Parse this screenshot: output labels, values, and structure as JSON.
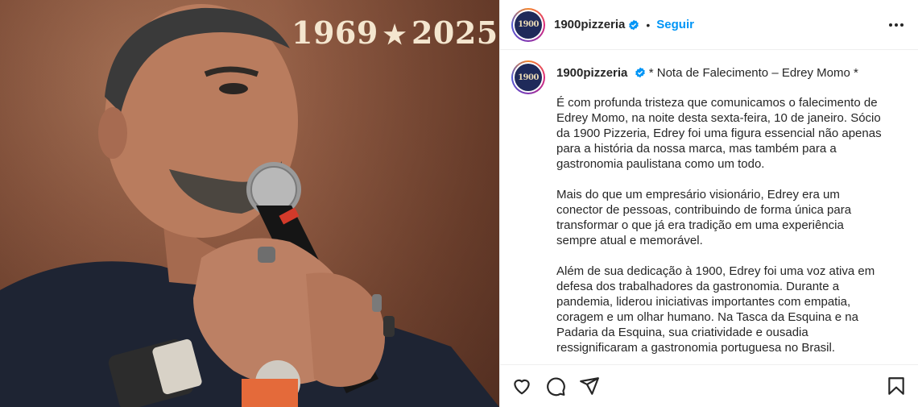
{
  "photo": {
    "overlay_years_start": "1969",
    "overlay_star": "★",
    "overlay_years_end": "2025"
  },
  "header": {
    "avatar_text": "1900",
    "username": "1900pizzeria",
    "separator": "•",
    "follow_label": "Seguir"
  },
  "caption": {
    "avatar_text": "1900",
    "username": "1900pizzeria",
    "headline": "* Nota de Falecimento – Edrey Momo *",
    "paragraphs": [
      "É com profunda tristeza que comunicamos o falecimento de Edrey Momo, na noite desta sexta-feira, 10 de janeiro. Sócio da 1900 Pizzeria, Edrey foi uma figura essencial não apenas para a história da nossa marca, mas também para a gastronomia paulistana como um todo.",
      "Mais do que um empresário visionário, Edrey era um conector de pessoas, contribuindo de forma única para transformar o que já era tradição em uma experiência sempre atual e memorável.",
      "Além de sua dedicação à 1900, Edrey foi uma voz ativa em defesa dos trabalhadores da gastronomia. Durante a pandemia, liderou iniciativas importantes com empatia, coragem e um olhar humano. Na Tasca da Esquina e na Padaria da Esquina, sua criatividade e ousadia ressignificaram a gastronomia portuguesa no Brasil."
    ]
  },
  "colors": {
    "follow": "#0095f6",
    "verified": "#0095f6",
    "text": "#262626",
    "logo_bg": "#1f2a5a"
  },
  "icons": [
    "heart-icon",
    "comment-icon",
    "share-icon",
    "bookmark-icon",
    "more-icon",
    "verified-badge-icon"
  ]
}
